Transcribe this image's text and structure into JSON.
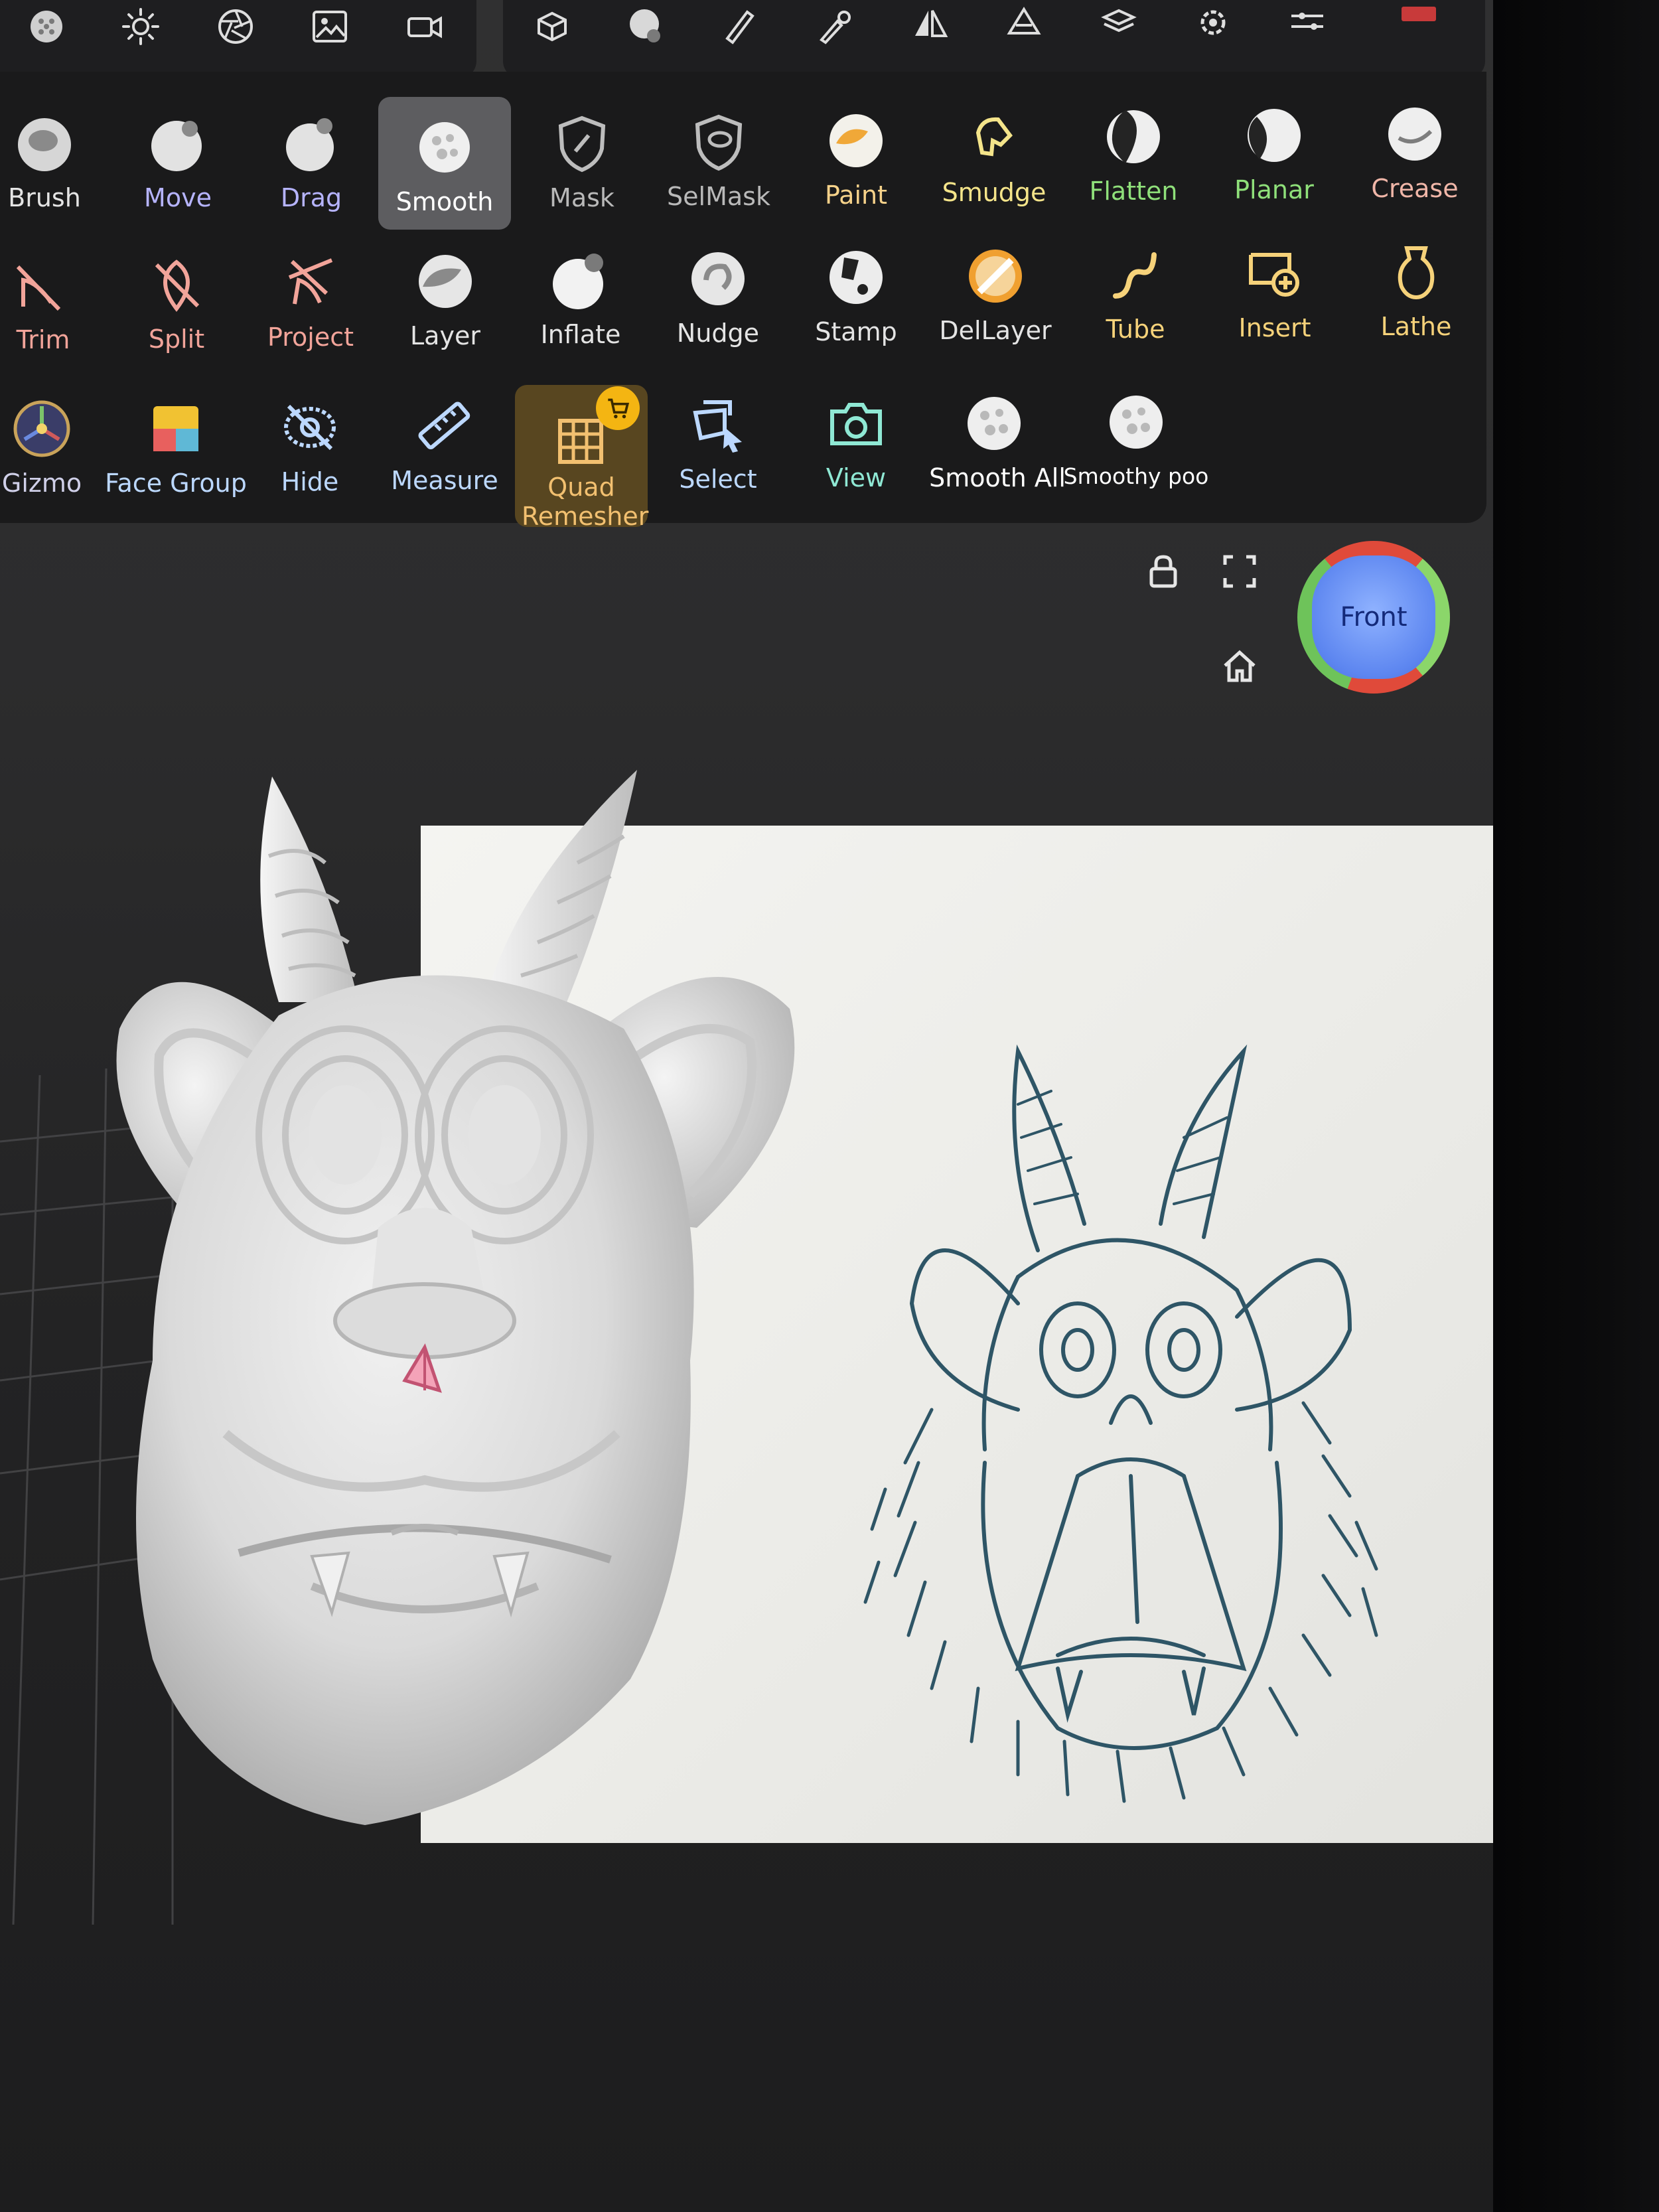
{
  "tools": {
    "row1": [
      {
        "label": "Brush",
        "color": "#e4e4e4",
        "icon": "brush-icon"
      },
      {
        "label": "Move",
        "color": "#b6b4ff",
        "icon": "move-icon"
      },
      {
        "label": "Drag",
        "color": "#b6b4ff",
        "icon": "drag-icon"
      },
      {
        "label": "Smooth",
        "color": "#ffffff",
        "icon": "smooth-icon",
        "active": true
      },
      {
        "label": "Mask",
        "color": "#b9b9b9",
        "icon": "mask-icon"
      },
      {
        "label": "SelMask",
        "color": "#b9b9b9",
        "icon": "selmask-icon"
      },
      {
        "label": "Paint",
        "color": "#f6d28a",
        "icon": "paint-icon"
      },
      {
        "label": "Smudge",
        "color": "#f4e48a",
        "icon": "smudge-icon"
      },
      {
        "label": "Flatten",
        "color": "#8fe07a",
        "icon": "flatten-icon"
      },
      {
        "label": "Planar",
        "color": "#8fe07a",
        "icon": "planar-icon"
      },
      {
        "label": "Crease",
        "color": "#f0b6a8",
        "icon": "crease-icon"
      }
    ],
    "row2": [
      {
        "label": "Trim",
        "color": "#f2a49a",
        "icon": "trim-icon"
      },
      {
        "label": "Split",
        "color": "#f2a49a",
        "icon": "split-icon"
      },
      {
        "label": "Project",
        "color": "#f2a49a",
        "icon": "project-icon"
      },
      {
        "label": "Layer",
        "color": "#e4e4e4",
        "icon": "layer-icon"
      },
      {
        "label": "Inflate",
        "color": "#e4e4e4",
        "icon": "inflate-icon"
      },
      {
        "label": "Nudge",
        "color": "#e4e4e4",
        "icon": "nudge-icon"
      },
      {
        "label": "Stamp",
        "color": "#e4e4e4",
        "icon": "stamp-icon"
      },
      {
        "label": "DelLayer",
        "color": "#e4e4e4",
        "icon": "dellayer-icon"
      },
      {
        "label": "Tube",
        "color": "#f6d27a",
        "icon": "tube-icon"
      },
      {
        "label": "Insert",
        "color": "#f6d27a",
        "icon": "insert-icon"
      },
      {
        "label": "Lathe",
        "color": "#f6d27a",
        "icon": "lathe-icon"
      }
    ],
    "row3": [
      {
        "label": "Gizmo",
        "color": "#cfcfe8",
        "icon": "gizmo-icon"
      },
      {
        "label": "Face Group",
        "color": "#bcd8ff",
        "icon": "face-group-icon"
      },
      {
        "label": "Hide",
        "color": "#bcd8ff",
        "icon": "hide-icon"
      },
      {
        "label": "Measure",
        "color": "#bcd8ff",
        "icon": "measure-icon"
      },
      {
        "label": "Quad Remesher",
        "color": "#f2c070",
        "icon": "quad-remesher-icon",
        "promo": true
      },
      {
        "label": "Select",
        "color": "#bcd8ff",
        "icon": "select-icon"
      },
      {
        "label": "View",
        "color": "#8fe8d4",
        "icon": "camera-icon"
      },
      {
        "label": "Smooth All",
        "color": "#ffffff",
        "icon": "smooth-all-icon"
      },
      {
        "label": "Smoothy poo",
        "color": "#ffffff",
        "icon": "smoothy-poo-icon"
      }
    ]
  },
  "viewport": {
    "navcube_label": "Front"
  },
  "colors": {
    "panel": "#1a1a1b",
    "active_tool": "#5d5d60",
    "promo_tool": "#584620",
    "viewport_bg": "#2c2c2d"
  }
}
